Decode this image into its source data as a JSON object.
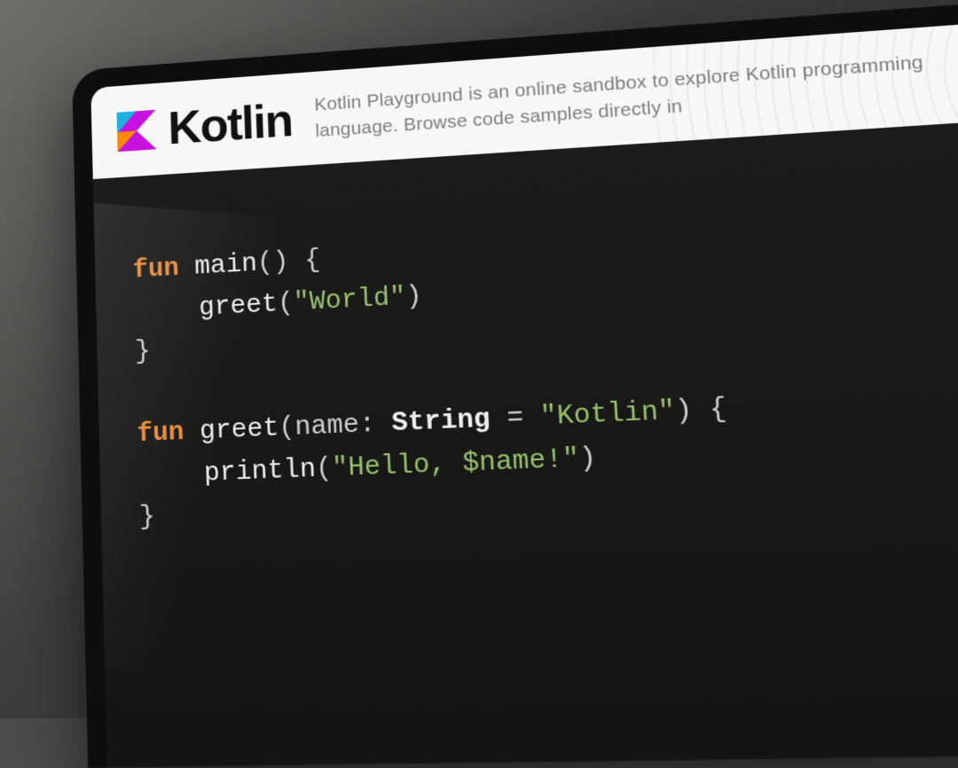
{
  "header": {
    "brand": "Kotlin",
    "tagline": "Kotlin Playground is an online sandbox to explore Kotlin programming language. Browse code samples directly in"
  },
  "code": {
    "kw_fun": "fun",
    "fn_main": "main",
    "open_paren": "(",
    "close_paren": ")",
    "open_brace": "{",
    "close_brace": "}",
    "fn_greet_call": "greet",
    "str_world": "\"World\"",
    "fn_greet_def": "greet",
    "param_name": "name",
    "colon": ":",
    "type_string": "String",
    "equals": "=",
    "str_kotlin": "\"Kotlin\"",
    "fn_println": "println",
    "str_hello": "\"Hello, $name!\""
  }
}
